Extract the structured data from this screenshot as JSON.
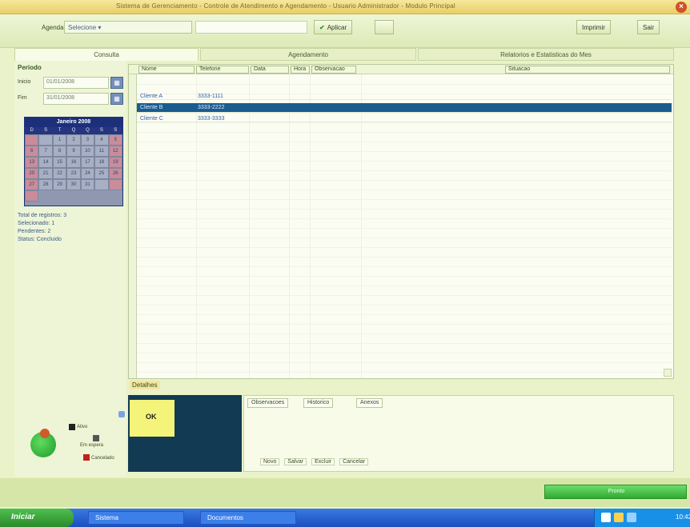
{
  "window": {
    "title": "Sistema de Gerenciamento - Controle de Atendimento e Agendamento - Usuario Administrador - Modulo Principal",
    "close_label": "×"
  },
  "toolbar": {
    "label": "Agenda:",
    "select_value": "Selecione ▾",
    "apply_label": "Aplicar",
    "extra_btn": "",
    "btn_right1": "Imprimir",
    "btn_right2": "Sair"
  },
  "tabs": [
    "Consulta",
    "Agendamento",
    "Relatorios e Estatisticas do Mes"
  ],
  "left": {
    "header": "Periodo",
    "rows": [
      {
        "label": "Inicio",
        "value": "01/01/2008"
      },
      {
        "label": "Fim",
        "value": "31/01/2008"
      }
    ],
    "calendar_title": "Janeiro 2008",
    "dow": [
      "D",
      "S",
      "T",
      "Q",
      "Q",
      "S",
      "S"
    ],
    "days": [
      "",
      "",
      "1",
      "2",
      "3",
      "4",
      "5",
      "6",
      "7",
      "8",
      "9",
      "10",
      "11",
      "12",
      "13",
      "14",
      "15",
      "16",
      "17",
      "18",
      "19",
      "20",
      "21",
      "22",
      "23",
      "24",
      "25",
      "26",
      "27",
      "28",
      "29",
      "30",
      "31",
      "",
      "",
      ""
    ],
    "info_lines": [
      "Total de registros: 3",
      "Selecionado: 1",
      "Pendentes: 2",
      "Status: Concluido"
    ]
  },
  "grid": {
    "headers": [
      "Nome",
      "Telefone",
      "Data",
      "Hora",
      "Observacao",
      "Situacao"
    ],
    "rows": [
      [
        "Cliente A",
        "3333-1111",
        "",
        ""
      ],
      [
        "Cliente B",
        "3333-2222",
        "",
        ""
      ],
      [
        "Cliente C",
        "3333-3333",
        "",
        ""
      ]
    ]
  },
  "bottom": {
    "label": "Detalhes",
    "yellow_text": "OK",
    "detail_tabs": [
      "Observacoes",
      "Historico",
      "Anexos"
    ],
    "detail_bottom": [
      "Novo",
      "Salvar",
      "Excluir",
      "Cancelar"
    ]
  },
  "indicators": [
    "Ativo",
    "Em espera",
    "Cancelado"
  ],
  "status": {
    "progress_label": "Pronto"
  },
  "taskbar": {
    "start": "Iniciar",
    "tasks": [
      "Sistema",
      "Documentos"
    ],
    "clock": "10:42"
  }
}
